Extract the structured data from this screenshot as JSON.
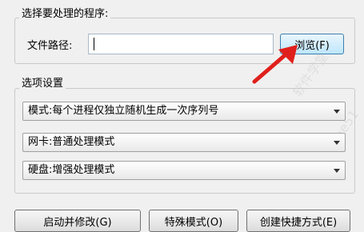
{
  "file_group": {
    "title": "选择要处理的程序:",
    "path_label": "文件路径:",
    "path_value": "",
    "browse_label": "浏览(F)"
  },
  "options_group": {
    "title": "选项设置",
    "mode_select": "模式:每个进程仅独立随机生成一次序列号",
    "nic_select": "网卡:普通处理模式",
    "disk_select": "硬盘:增强处理模式"
  },
  "buttons": {
    "start_modify": "启动并修改(G)",
    "special_mode": "特殊模式(O)",
    "create_shortcut": "创建快捷方式(E)"
  },
  "annotation_color": "#e0201c"
}
